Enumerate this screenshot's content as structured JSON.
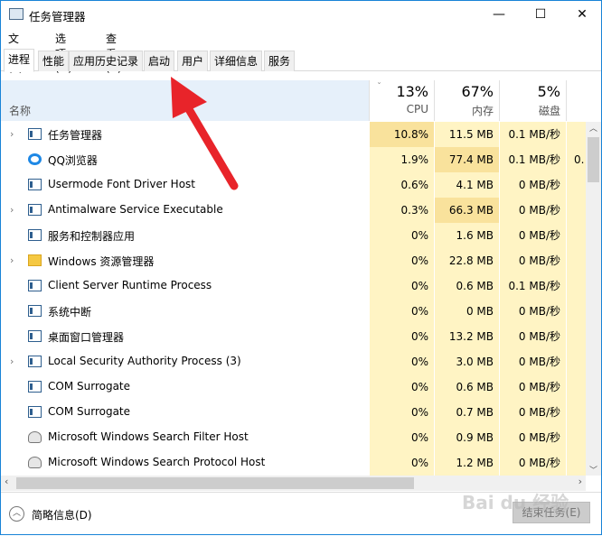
{
  "window": {
    "title": "任务管理器",
    "minimize": "—",
    "maximize": "☐",
    "close": "✕"
  },
  "menu": [
    "文件(F)",
    "选项(O)",
    "查看(V)"
  ],
  "tabs": [
    "进程",
    "性能",
    "应用历史记录",
    "启动",
    "用户",
    "详细信息",
    "服务"
  ],
  "header": {
    "name": "名称",
    "cpu_pct": "13%",
    "cpu": "CPU",
    "mem_pct": "67%",
    "mem": "内存",
    "disk_pct": "5%",
    "disk": "磁盘"
  },
  "processes": [
    {
      "name": "任务管理器",
      "cpu": "10.8%",
      "mem": "11.5 MB",
      "disk": "0.1 MB/秒",
      "icon": "taskmgr",
      "expandable": true
    },
    {
      "name": "QQ浏览器",
      "cpu": "1.9%",
      "mem": "77.4 MB",
      "disk": "0.1 MB/秒",
      "icon": "qq",
      "expandable": false,
      "extra": "0."
    },
    {
      "name": "Usermode Font Driver Host",
      "cpu": "0.6%",
      "mem": "4.1 MB",
      "disk": "0 MB/秒",
      "icon": "app",
      "expandable": false
    },
    {
      "name": "Antimalware Service Executable",
      "cpu": "0.3%",
      "mem": "66.3 MB",
      "disk": "0 MB/秒",
      "icon": "app",
      "expandable": true
    },
    {
      "name": "服务和控制器应用",
      "cpu": "0%",
      "mem": "1.6 MB",
      "disk": "0 MB/秒",
      "icon": "app",
      "expandable": false
    },
    {
      "name": "Windows 资源管理器",
      "cpu": "0%",
      "mem": "22.8 MB",
      "disk": "0 MB/秒",
      "icon": "folder",
      "expandable": true
    },
    {
      "name": "Client Server Runtime Process",
      "cpu": "0%",
      "mem": "0.6 MB",
      "disk": "0.1 MB/秒",
      "icon": "app",
      "expandable": false
    },
    {
      "name": "系统中断",
      "cpu": "0%",
      "mem": "0 MB",
      "disk": "0 MB/秒",
      "icon": "app",
      "expandable": false
    },
    {
      "name": "桌面窗口管理器",
      "cpu": "0%",
      "mem": "13.2 MB",
      "disk": "0 MB/秒",
      "icon": "app",
      "expandable": false
    },
    {
      "name": "Local Security Authority Process (3)",
      "cpu": "0%",
      "mem": "3.0 MB",
      "disk": "0 MB/秒",
      "icon": "app",
      "expandable": true
    },
    {
      "name": "COM Surrogate",
      "cpu": "0%",
      "mem": "0.6 MB",
      "disk": "0 MB/秒",
      "icon": "app",
      "expandable": false
    },
    {
      "name": "COM Surrogate",
      "cpu": "0%",
      "mem": "0.7 MB",
      "disk": "0 MB/秒",
      "icon": "app",
      "expandable": false
    },
    {
      "name": "Microsoft Windows Search Filter Host",
      "cpu": "0%",
      "mem": "0.9 MB",
      "disk": "0 MB/秒",
      "icon": "user",
      "expandable": false
    },
    {
      "name": "Microsoft Windows Search Protocol Host",
      "cpu": "0%",
      "mem": "1.2 MB",
      "disk": "0 MB/秒",
      "icon": "user",
      "expandable": false
    }
  ],
  "footer": {
    "fewer_details": "简略信息(D)",
    "end_task": "结束任务(E)"
  },
  "watermark": "Baidu经验 jingyan.baidu.com",
  "annotation_color": "#e8242a"
}
